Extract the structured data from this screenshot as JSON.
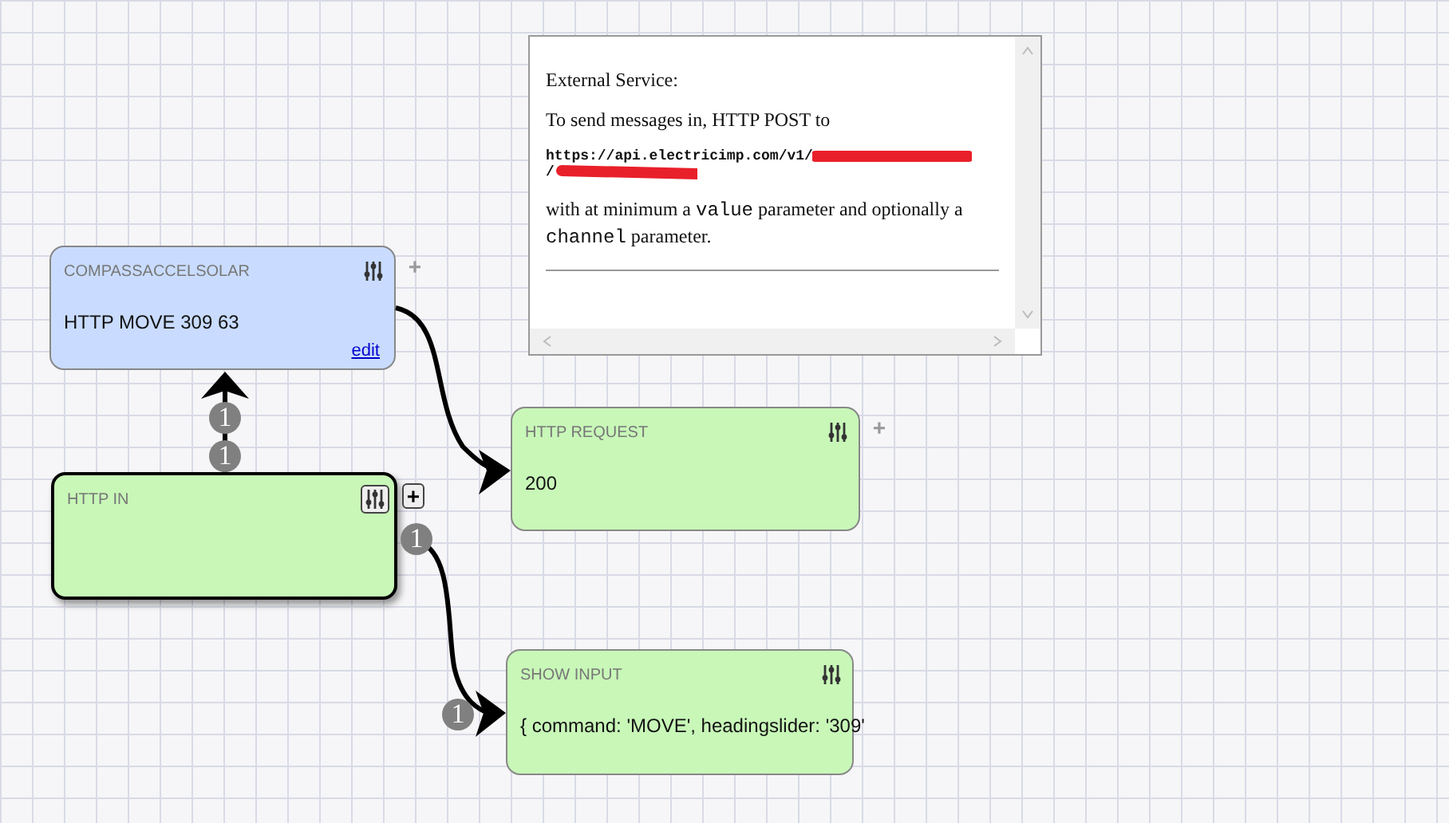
{
  "info_panel": {
    "heading": "External Service:",
    "intro": "To send messages in, HTTP POST to",
    "url_lines": [
      "https://api.electricimp.com/v1/",
      "/"
    ],
    "note": [
      {
        "kind": "text",
        "text": "with at minimum a"
      },
      {
        "kind": "code",
        "text": "value"
      },
      {
        "kind": "text",
        "text": "parameter and optionally a"
      },
      {
        "kind": "code",
        "text": "channel"
      },
      {
        "kind": "text",
        "text": "parameter."
      }
    ]
  },
  "nodes": [
    {
      "title": "COMPASSACCELSOLAR",
      "body": "HTTP MOVE 309 63",
      "link": "edit",
      "kind": "output",
      "selected": false,
      "add_button": "+"
    },
    {
      "title": "HTTP IN",
      "kind": "input",
      "selected": true,
      "add_button": "+"
    },
    {
      "title": "HTTP REQUEST",
      "body": "200",
      "kind": "process",
      "selected": false,
      "add_button": "+"
    },
    {
      "title": "SHOW INPUT",
      "body": "{ command: 'MOVE', headingslider: '309'",
      "kind": "process",
      "selected": false
    }
  ],
  "badges": [
    "1",
    "1",
    "1",
    "1"
  ]
}
